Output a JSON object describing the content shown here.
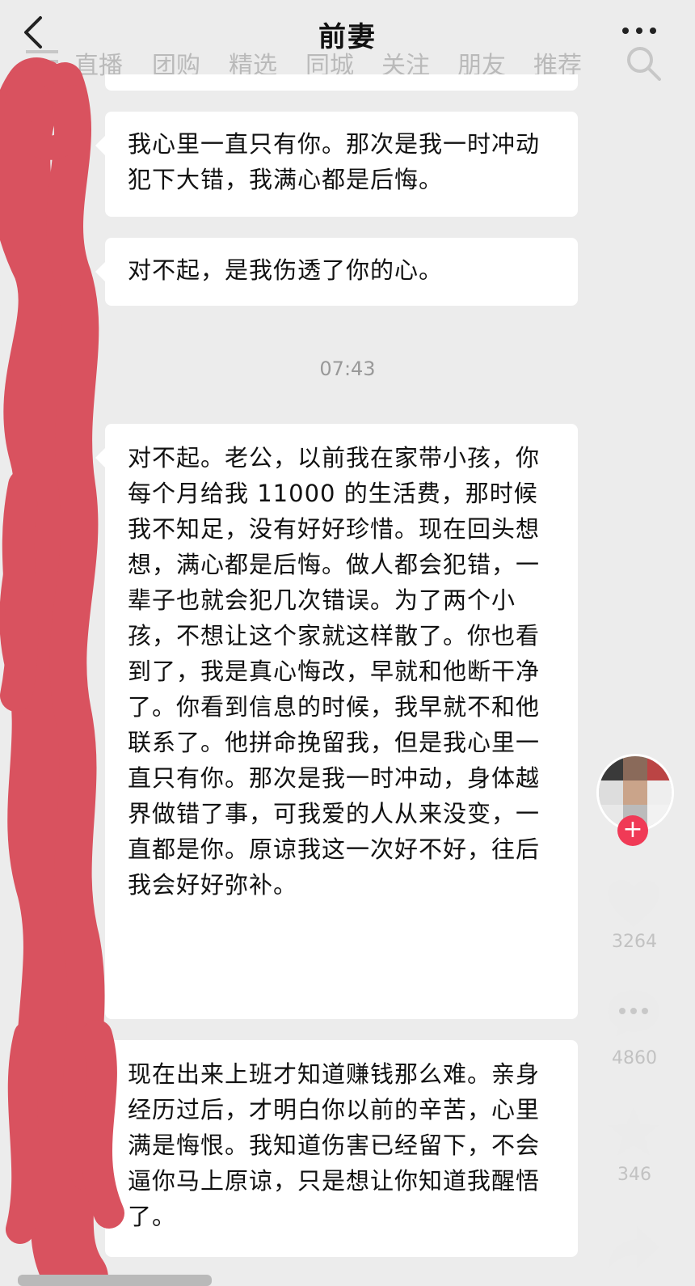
{
  "header": {
    "title": "前妻"
  },
  "overlay_nav": {
    "tabs": [
      "直播",
      "团购",
      "精选",
      "同城",
      "关注",
      "朋友",
      "推荐"
    ]
  },
  "messages": [
    {
      "text": "我心里一直只有你。那次是我一时冲动犯下大错，我满心都是后悔。"
    },
    {
      "text": "对不起，是我伤透了你的心。"
    },
    {
      "text": "对不起。老公，以前我在家带小孩，你每个月给我 11000 的生活费，那时候我不知足，没有好好珍惜。现在回头想想，满心都是后悔。做人都会犯错，一辈子也就会犯几次错误。为了两个小孩，不想让这个家就这样散了。你也看到了，我是真心悔改，早就和他断干净了。你看到信息的时候，我早就不和他联系了。他拼命挽留我，但是我心里一直只有你。那次是我一时冲动，身体越界做错了事，可我爱的人从来没变，一直都是你。原谅我这一次好不好，往后我会好好弥补。"
    },
    {
      "text": "现在出来上班才知道赚钱那么难。亲身经历过后，才明白你以前的辛苦，心里满是悔恨。我知道伤害已经留下，不会逼你马上原谅，只是想让你知道我醒悟了。"
    }
  ],
  "timestamp": "07:43",
  "rail": {
    "follow_symbol": "+",
    "likes": "3264",
    "comments": "4860",
    "favorites": "346"
  },
  "colors": {
    "background": "#ececec",
    "bubble": "#ffffff",
    "scribble": "#d9525f",
    "follow_badge": "#f03a56"
  }
}
